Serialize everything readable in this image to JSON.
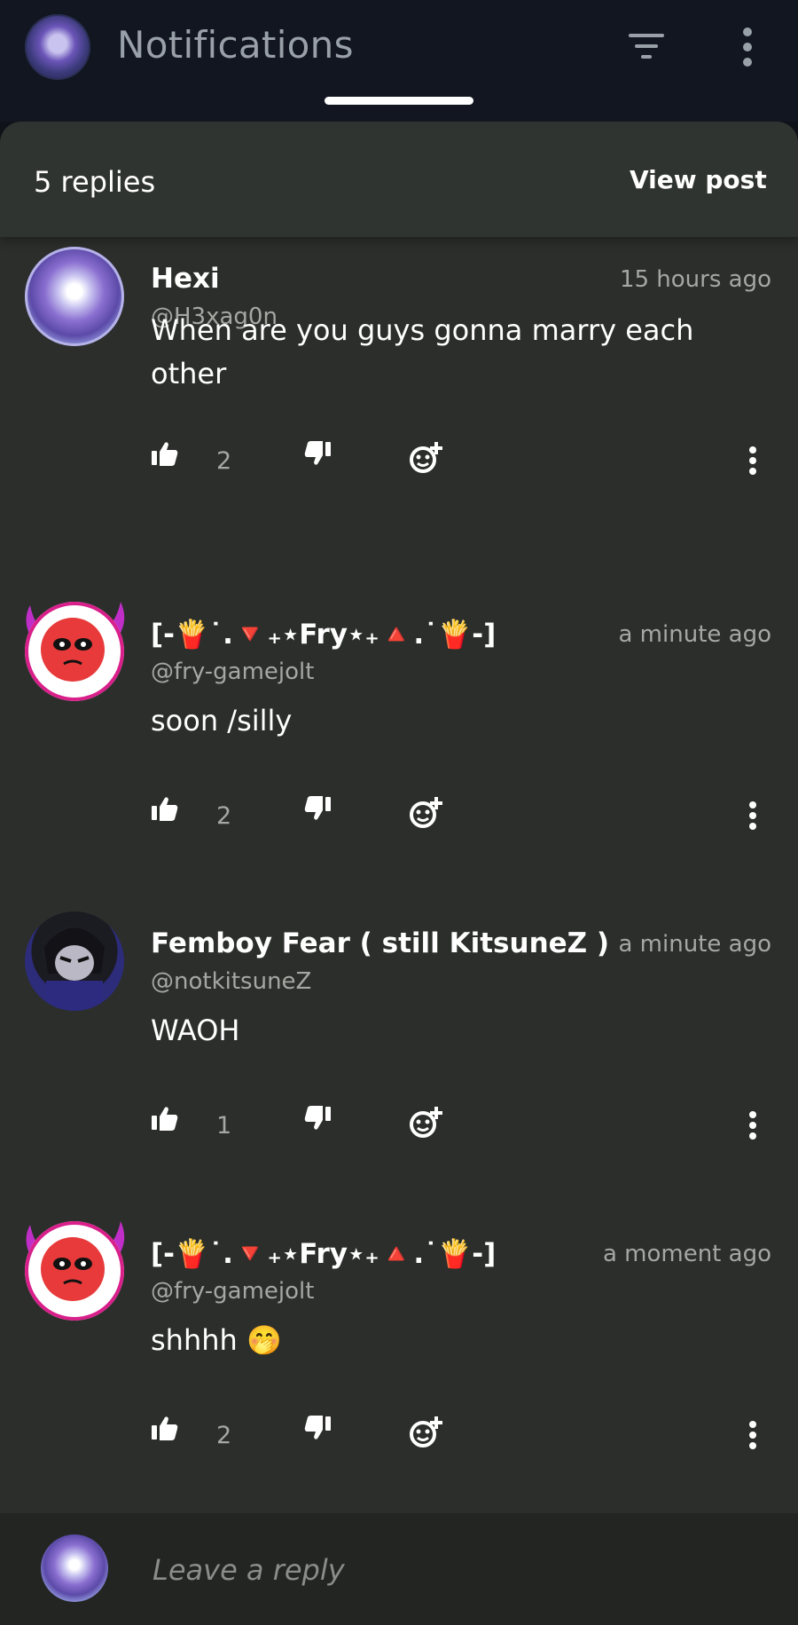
{
  "topbar": {
    "title": "Notifications",
    "icons": [
      "avatar",
      "filter-icon",
      "more-vertical-icon"
    ]
  },
  "sheet": {
    "replies_count": "5 replies",
    "view_post_label": "View post"
  },
  "comments": [
    {
      "name": "Hexi",
      "handle": "@H3xag0n",
      "time": "15 hours ago",
      "text": "When are you guys gonna marry each other",
      "likes": "2"
    },
    {
      "name": "[-🍟˙.🔻₊⋆Fry⋆₊🔺.˙🍟-]",
      "handle": "@fry-gamejolt",
      "time": "a minute ago",
      "text": "soon /silly",
      "likes": "2"
    },
    {
      "name": "Femboy Fear ( still KitsuneZ )",
      "handle": "@notkitsuneZ",
      "time": "a minute ago",
      "text": "WAOH",
      "likes": "1"
    },
    {
      "name": "[-🍟˙.🔻₊⋆Fry⋆₊🔺.˙🍟-]",
      "handle": "@fry-gamejolt",
      "time": "a moment ago",
      "text": "shhhh 🤭",
      "likes": "2"
    }
  ],
  "reply_bar": {
    "placeholder": "Leave a reply"
  },
  "colors": {
    "topbar_bg": "#111620",
    "sheet_bg": "#2b2e2a",
    "secondary_text": "#a5a7a3",
    "fry_ring": "#d81f8a"
  }
}
